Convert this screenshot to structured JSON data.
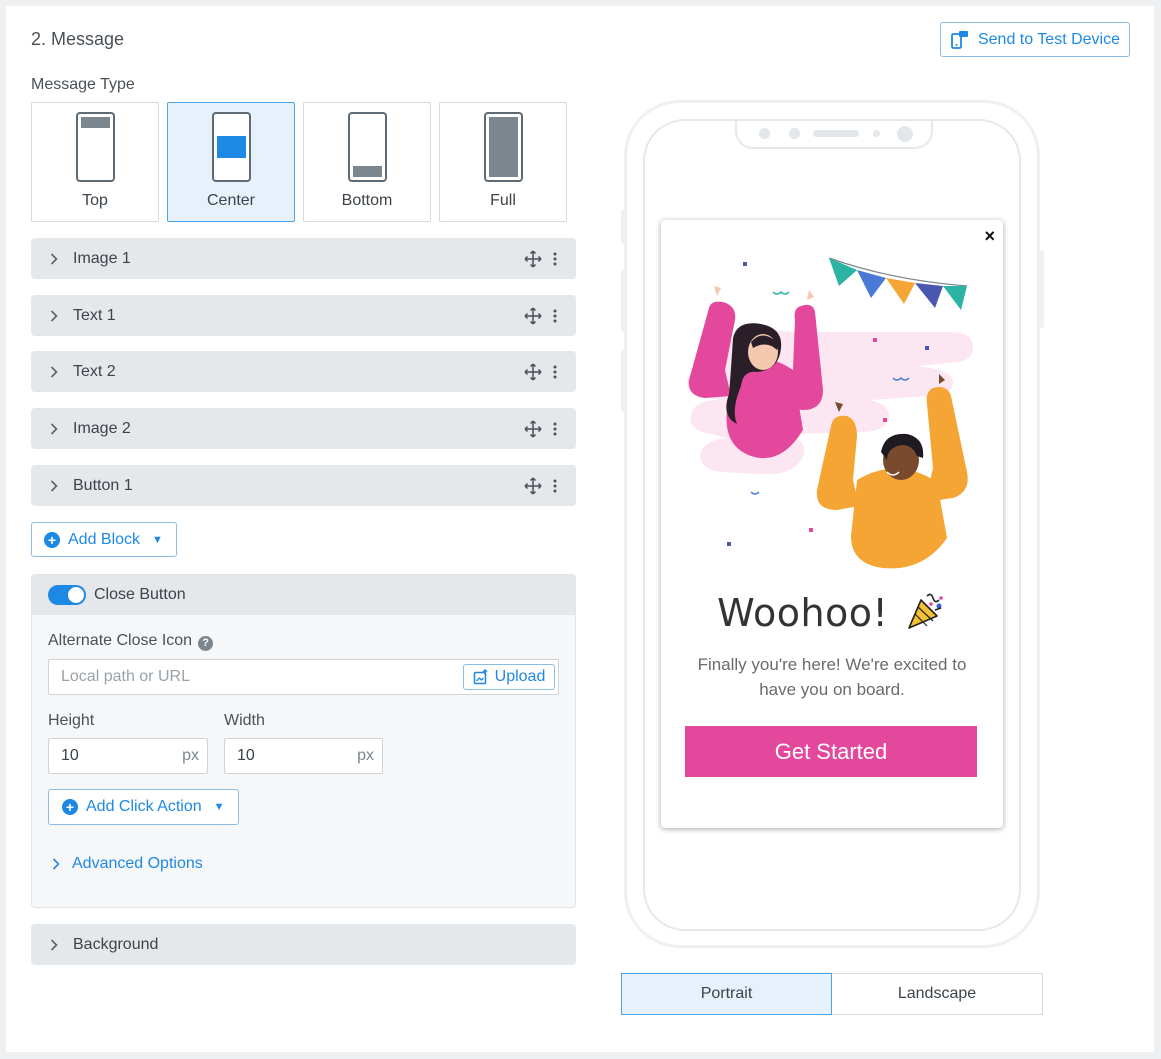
{
  "section": {
    "title": "2. Message",
    "test_button": "Send to Test Device"
  },
  "message_type": {
    "label": "Message Type",
    "options": [
      "Top",
      "Center",
      "Bottom",
      "Full"
    ],
    "selected": "Center"
  },
  "blocks": [
    {
      "label": "Image 1"
    },
    {
      "label": "Text 1"
    },
    {
      "label": "Text 2"
    },
    {
      "label": "Image 2"
    },
    {
      "label": "Button 1"
    }
  ],
  "add_block": "Add Block",
  "close_button": {
    "title": "Close Button",
    "enabled": true,
    "alt_icon_label": "Alternate Close Icon",
    "path_placeholder": "Local path or URL",
    "upload": "Upload",
    "height_label": "Height",
    "height_value": "10",
    "width_label": "Width",
    "width_value": "10",
    "unit": "px",
    "add_click_action": "Add Click Action",
    "advanced": "Advanced Options"
  },
  "background": "Background",
  "preview": {
    "close_glyph": "×",
    "title": "Woohoo!",
    "subtitle": "Finally you're here! We're excited to have you on board.",
    "cta": "Get Started"
  },
  "orientation": {
    "options": [
      "Portrait",
      "Landscape"
    ],
    "selected": "Portrait"
  },
  "colors": {
    "accent": "#1e88e5",
    "cta": "#e3489c"
  }
}
